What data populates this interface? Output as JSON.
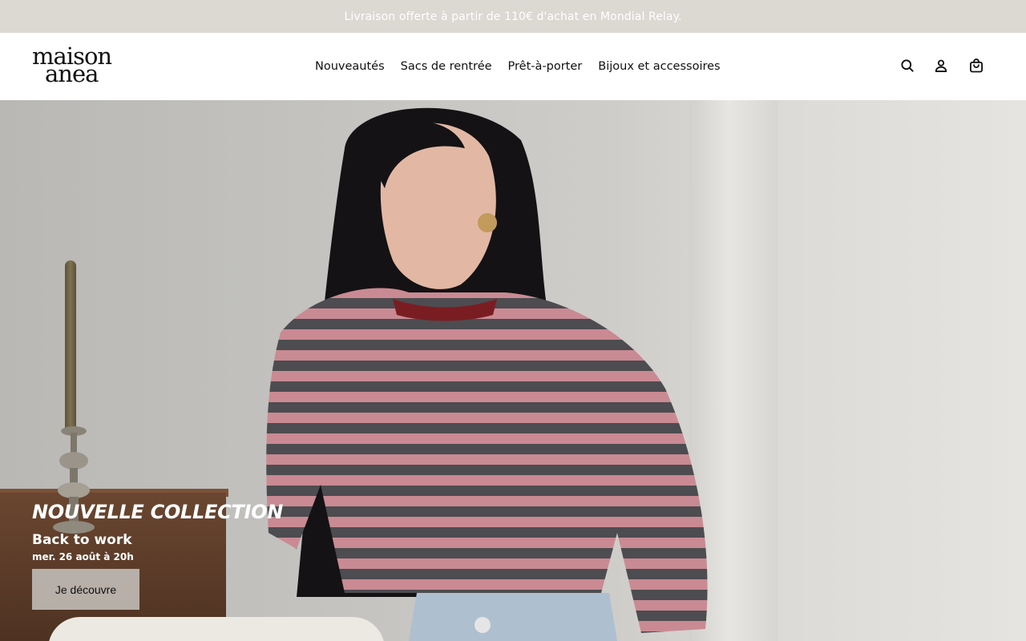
{
  "announcement": {
    "text": "Livraison offerte à partir de 110€ d'achat en Mondial Relay."
  },
  "logo": {
    "line1": "maison",
    "line2": "anea"
  },
  "nav": {
    "items": [
      "Nouveautés",
      "Sacs de rentrée",
      "Prêt-à-porter",
      "Bijoux et accessoires"
    ]
  },
  "icons": {
    "search": "search-icon",
    "account": "user-icon",
    "cart": "bag-icon"
  },
  "hero": {
    "kicker": "NOUVELLE COLLECTION",
    "title": "Back to work",
    "date": "mer. 26 août à 20h",
    "cta_label": "Je découvre"
  },
  "colors": {
    "announcement_bg": "#dcd8d2",
    "announcement_text": "#ffffff",
    "cta_bg": "#c8c4c0",
    "text": "#111111"
  }
}
